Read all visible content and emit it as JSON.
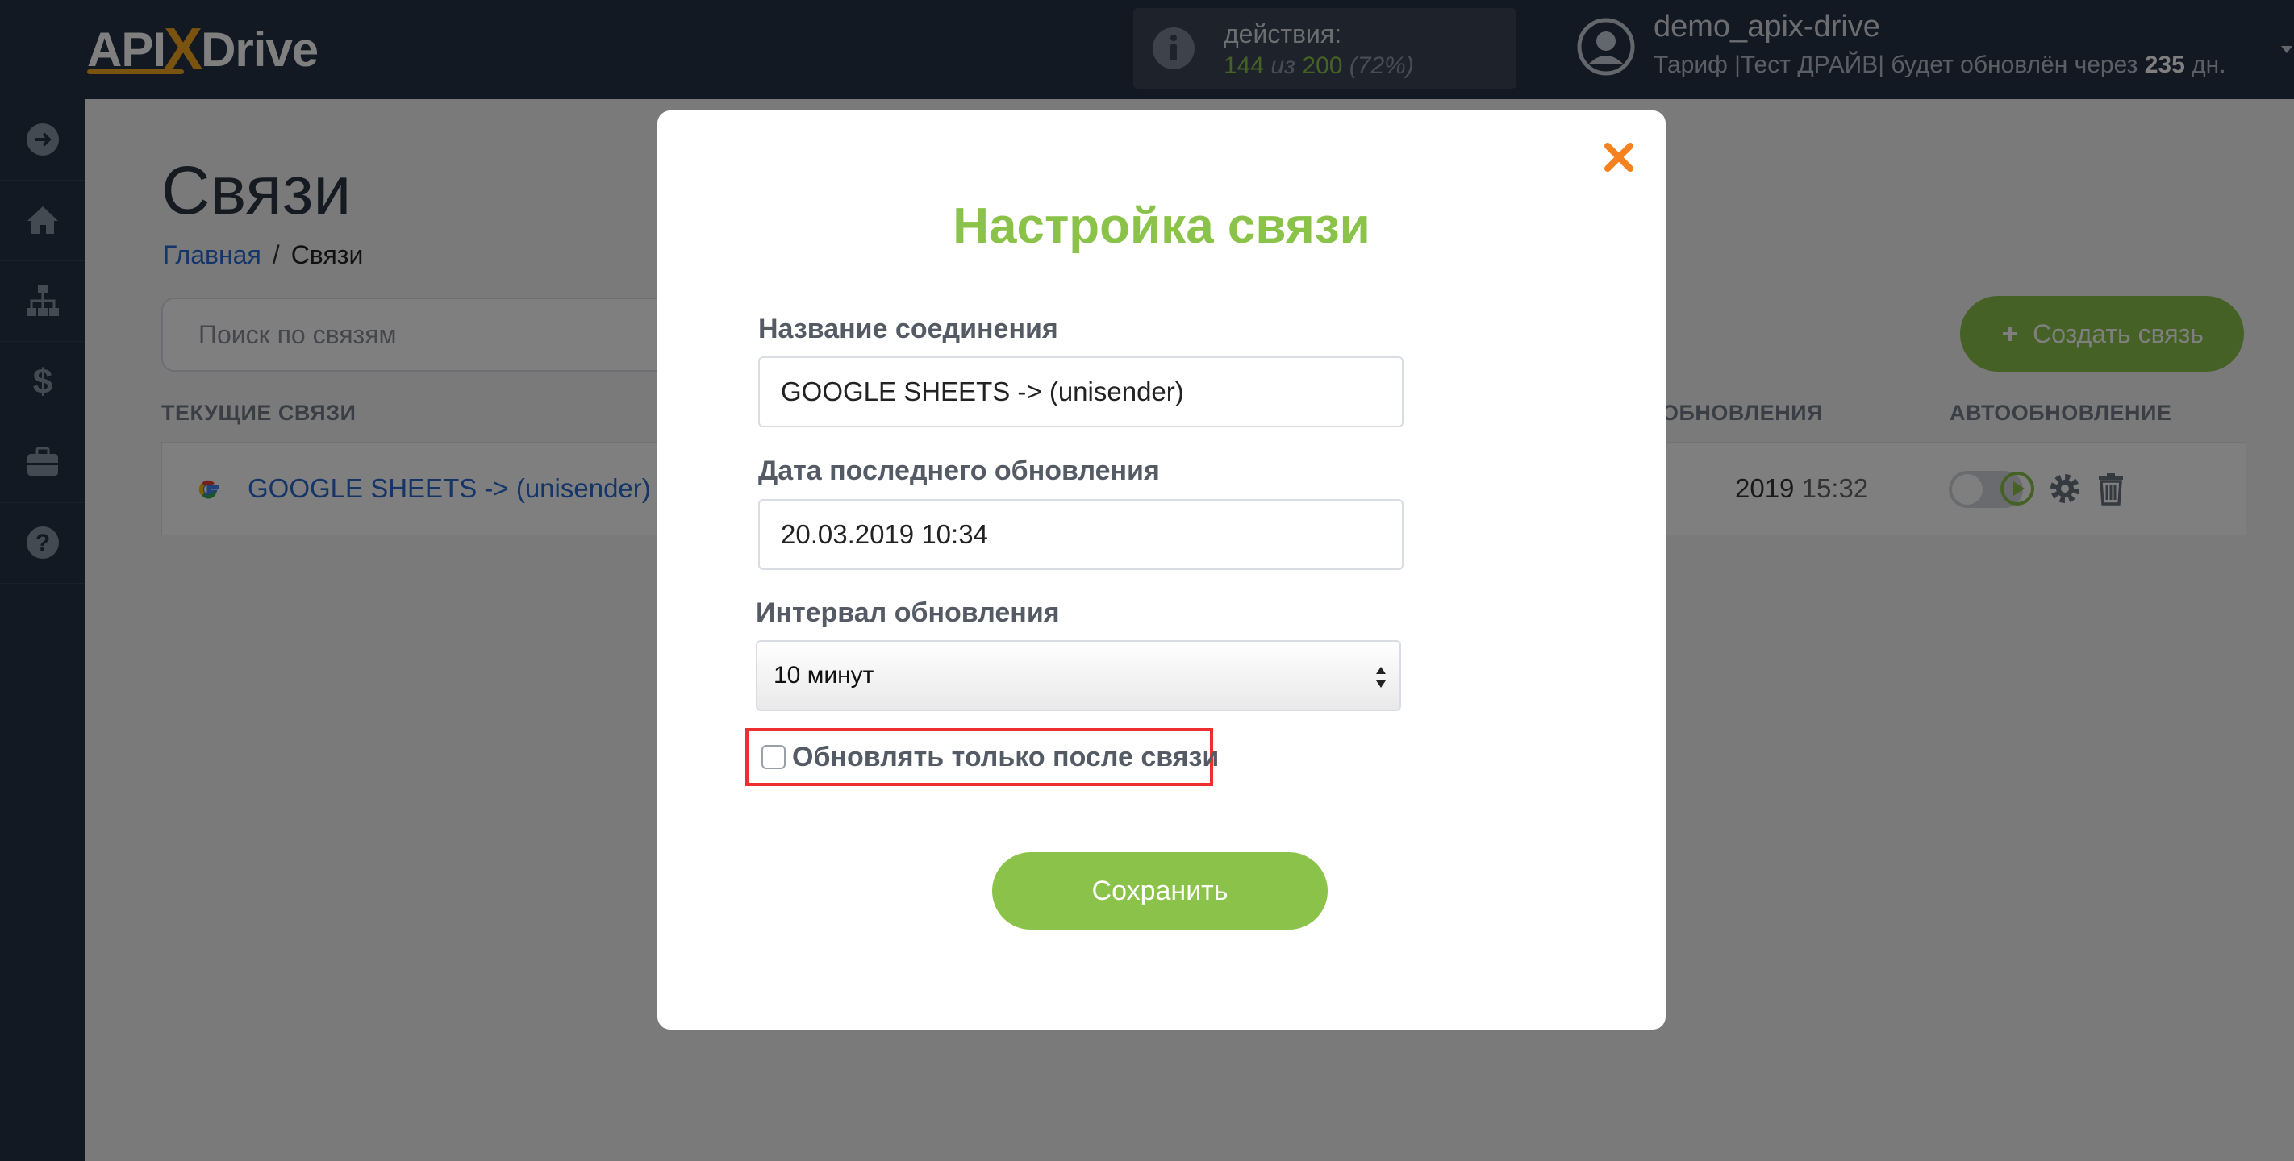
{
  "app": {
    "logo_part1": "API",
    "logo_x": "X",
    "logo_part2": "Drive",
    "accent_color": "#8bc34a",
    "logo_accent_color": "#f5a623"
  },
  "header": {
    "actions_label": "действия:",
    "actions_used": "144",
    "actions_of": "из",
    "actions_total": "200",
    "actions_percent": "(72%)",
    "username": "demo_apix-drive",
    "plan_prefix": "Тариф |Тест ДРАЙВ| будет обновлён через",
    "plan_days": "235",
    "plan_suffix": "дн."
  },
  "sidebar": {
    "items": [
      {
        "icon": "arrow-right-circle-icon"
      },
      {
        "icon": "home-icon"
      },
      {
        "icon": "sitemap-icon"
      },
      {
        "icon": "dollar-icon"
      },
      {
        "icon": "briefcase-icon"
      },
      {
        "icon": "question-circle-icon"
      }
    ]
  },
  "page": {
    "title": "Связи",
    "breadcrumb_home": "Главная",
    "breadcrumb_sep": "/",
    "breadcrumb_current": "Связи",
    "search_placeholder": "Поиск по связям",
    "create_button": "Создать связь",
    "create_button_icon": "plus-icon",
    "col_current": "ТЕКУЩИЕ СВЯЗИ",
    "col_update": "ОБНОВЛЕНИЯ",
    "col_autoupdate": "АВТООБНОВЛЕНИЕ",
    "row": {
      "name": "GOOGLE SHEETS -> (unisender)",
      "date": "2019",
      "time": "15:32",
      "autoupdate_on": false
    }
  },
  "modal": {
    "title": "Настройка связи",
    "name_label": "Название соединения",
    "name_value": "GOOGLE SHEETS -> (unisender)",
    "date_label": "Дата последнего обновления",
    "date_value": "20.03.2019 10:34",
    "interval_label": "Интервал обновления",
    "interval_value": "10 минут",
    "checkbox_label": "Обновлять только после связи",
    "checkbox_checked": false,
    "save_button": "Сохранить"
  }
}
